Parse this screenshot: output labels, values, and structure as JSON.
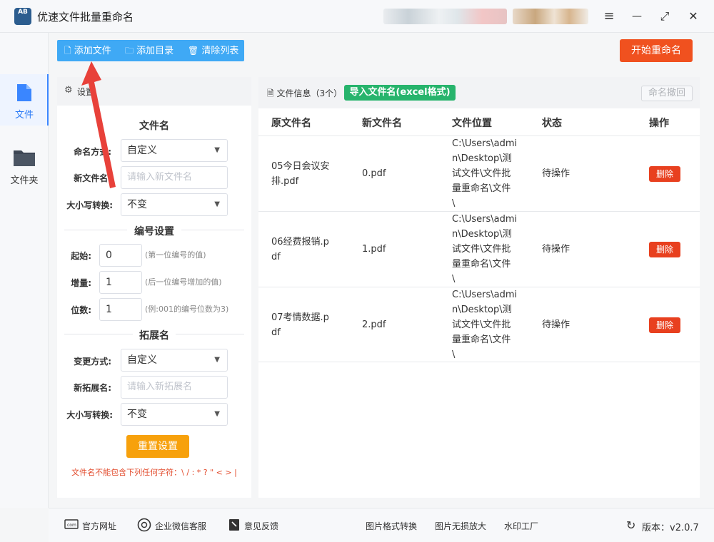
{
  "app": {
    "title": "优速文件批量重命名",
    "logo_text": "AB"
  },
  "window_controls": {
    "menu": "≡",
    "minimize": "—",
    "maximize": "⤢",
    "close": "✕"
  },
  "leftnav": [
    {
      "label": "文件",
      "icon": "file-icon",
      "active": true
    },
    {
      "label": "文件夹",
      "icon": "folder-icon",
      "active": false
    }
  ],
  "toolbar": {
    "add_file": "添加文件",
    "add_dir": "添加目录",
    "clear_list": "清除列表",
    "start_rename": "开始重命名"
  },
  "settings": {
    "header": "设置",
    "filename_section": "文件名",
    "naming_mode_label": "命名方式:",
    "naming_mode_value": "自定义",
    "new_filename_label": "新文件名:",
    "new_filename_placeholder": "请输入新文件名",
    "case_label": "大小写转换:",
    "case_value": "不变",
    "numbering_section": "编号设置",
    "start_label": "起始:",
    "start_value": "0",
    "start_hint": "(第一位编号的值)",
    "step_label": "增量:",
    "step_value": "1",
    "step_hint": "(后一位编号增加的值)",
    "digits_label": "位数:",
    "digits_value": "1",
    "digits_hint": "(例:001的编号位数为3)",
    "ext_section": "拓展名",
    "ext_mode_label": "变更方式:",
    "ext_mode_value": "自定义",
    "new_ext_label": "新拓展名:",
    "new_ext_placeholder": "请输入新拓展名",
    "ext_case_label": "大小写转换:",
    "ext_case_value": "不变",
    "reset_button": "重置设置",
    "warning": "文件名不能包含下列任何字符：\\ / : * ? \" < > |"
  },
  "filepanel": {
    "title": "文件信息（3个）",
    "import_button": "导入文件名(excel格式)",
    "undo_button": "命名撤回",
    "columns": [
      "原文件名",
      "新文件名",
      "文件位置",
      "状态",
      "操作"
    ],
    "rows": [
      {
        "original_l1": "05今日会议安",
        "original_l2": "排.pdf",
        "new_name": "0.pdf",
        "loc1": "C:\\Users\\admi",
        "loc2": "n\\Desktop\\测",
        "loc3": "试文件\\文件批",
        "loc4": "量重命名\\文件",
        "loc5": "\\",
        "status": "待操作",
        "action": "删除"
      },
      {
        "original_l1": "06经费报销.p",
        "original_l2": "df",
        "new_name": "1.pdf",
        "loc1": "C:\\Users\\admi",
        "loc2": "n\\Desktop\\测",
        "loc3": "试文件\\文件批",
        "loc4": "量重命名\\文件",
        "loc5": "\\",
        "status": "待操作",
        "action": "删除"
      },
      {
        "original_l1": "07考情数据.p",
        "original_l2": "df",
        "new_name": "2.pdf",
        "loc1": "C:\\Users\\admi",
        "loc2": "n\\Desktop\\测",
        "loc3": "试文件\\文件批",
        "loc4": "量重命名\\文件",
        "loc5": "\\",
        "status": "待操作",
        "action": "删除"
      }
    ]
  },
  "footer": {
    "website": "官方网址",
    "wechat": "企业微信客服",
    "feedback": "意见反馈",
    "img_convert": "图片格式转换",
    "img_enlarge": "图片无损放大",
    "watermark": "水印工厂",
    "version": "版本：v2.0.7"
  },
  "colors": {
    "accent": "#3fa9f5",
    "start": "#f0511f",
    "import": "#27b46c",
    "reset": "#f7a10c",
    "delete": "#e8401f",
    "arrow": "#e8413a"
  }
}
